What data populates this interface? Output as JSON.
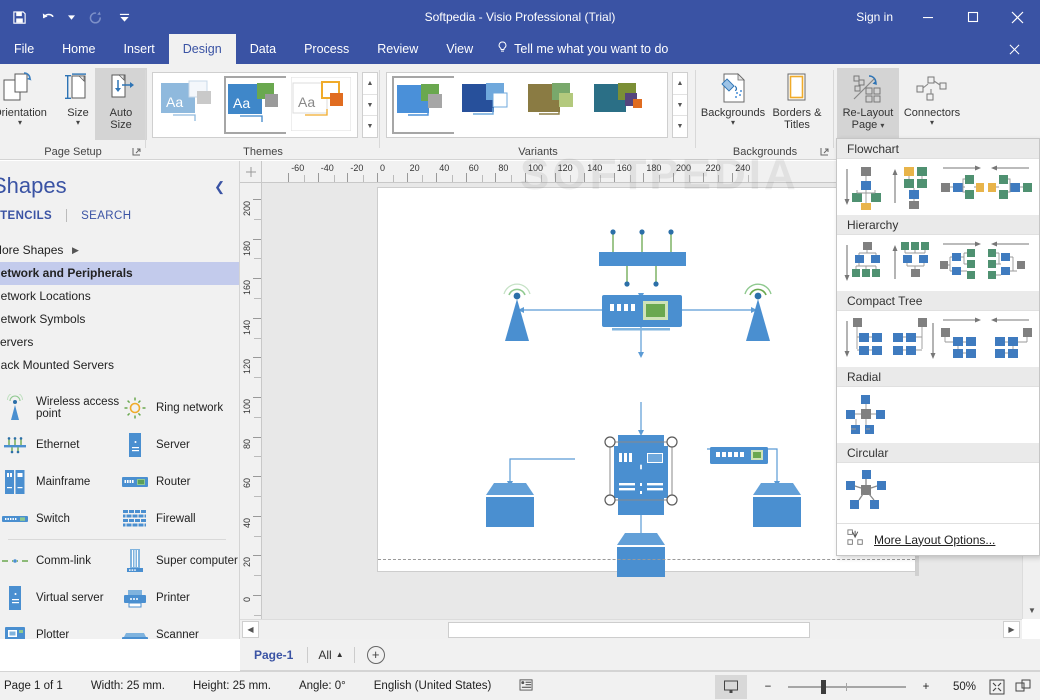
{
  "titlebar": {
    "document_title": "Softpedia - Visio Professional (Trial)",
    "signin": "Sign in",
    "qat": [
      {
        "name": "save-icon",
        "label": "Save"
      },
      {
        "name": "undo-icon",
        "label": "Undo"
      },
      {
        "name": "redo-icon",
        "label": "Redo"
      },
      {
        "name": "customize-qat-icon",
        "label": "Customize Quick Access Toolbar"
      }
    ],
    "window_buttons": [
      {
        "name": "minimize-button",
        "glyph": "minimize"
      },
      {
        "name": "maximize-button",
        "glyph": "maximize"
      },
      {
        "name": "close-button",
        "glyph": "close"
      }
    ],
    "accent_color": "#3a53a4"
  },
  "ribbon_tabs": [
    {
      "label": "File",
      "active": false
    },
    {
      "label": "Home",
      "active": false
    },
    {
      "label": "Insert",
      "active": false
    },
    {
      "label": "Design",
      "active": true
    },
    {
      "label": "Data",
      "active": false
    },
    {
      "label": "Process",
      "active": false
    },
    {
      "label": "Review",
      "active": false
    },
    {
      "label": "View",
      "active": false
    }
  ],
  "tellme": "Tell me what you want to do",
  "ribbon": {
    "groups": [
      {
        "name": "page-setup",
        "label": "Page Setup"
      },
      {
        "name": "themes",
        "label": "Themes"
      },
      {
        "name": "variants",
        "label": "Variants"
      },
      {
        "name": "backgrounds",
        "label": "Backgrounds"
      },
      {
        "name": "layout",
        "label": ""
      }
    ],
    "page_setup": {
      "orientation": "Orientation",
      "size": "Size",
      "autosize_line1": "Auto",
      "autosize_line2": "Size"
    },
    "backgrounds": {
      "backgrounds": "Backgrounds",
      "borders_line1": "Borders &",
      "borders_line2": "Titles"
    },
    "layout": {
      "relayout_line1": "Re-Layout",
      "relayout_line2": "Page",
      "connectors": "Connectors"
    }
  },
  "shapes_panel": {
    "title": "Shapes",
    "tab_stencils": "STENCILS",
    "tab_search": "SEARCH",
    "collapse_icon": "chevron-left-icon",
    "stencils": [
      {
        "label": "More Shapes",
        "has_arrow": true,
        "selected": false
      },
      {
        "label": "Network and Peripherals",
        "has_arrow": false,
        "selected": true
      },
      {
        "label": "Network Locations",
        "has_arrow": false,
        "selected": false
      },
      {
        "label": "Network Symbols",
        "has_arrow": false,
        "selected": false
      },
      {
        "label": "Servers",
        "has_arrow": false,
        "selected": false
      },
      {
        "label": "Rack Mounted Servers",
        "has_arrow": false,
        "selected": false
      }
    ],
    "shapes": [
      {
        "label": "Wireless access point",
        "icon": "wireless-access-point-icon"
      },
      {
        "label": "Ring network",
        "icon": "ring-network-icon"
      },
      {
        "label": "Ethernet",
        "icon": "ethernet-icon"
      },
      {
        "label": "Server",
        "icon": "server-icon"
      },
      {
        "label": "Mainframe",
        "icon": "mainframe-icon"
      },
      {
        "label": "Router",
        "icon": "router-icon"
      },
      {
        "label": "Switch",
        "icon": "switch-icon"
      },
      {
        "label": "Firewall",
        "icon": "firewall-icon"
      },
      {
        "label": "Comm-link",
        "icon": "comm-link-icon"
      },
      {
        "label": "Super computer",
        "icon": "super-computer-icon"
      },
      {
        "label": "Virtual server",
        "icon": "virtual-server-icon"
      },
      {
        "label": "Printer",
        "icon": "printer-icon"
      },
      {
        "label": "Plotter",
        "icon": "plotter-icon"
      },
      {
        "label": "Scanner",
        "icon": "scanner-icon"
      }
    ]
  },
  "rulers": {
    "horizontal_ticks": [
      "-60",
      "-40",
      "-20",
      "0",
      "20",
      "40",
      "60",
      "80",
      "100",
      "120",
      "140",
      "160",
      "180",
      "200",
      "220",
      "240"
    ],
    "vertical_ticks": [
      "200",
      "180",
      "160",
      "140",
      "120",
      "100",
      "80",
      "60",
      "40",
      "20",
      "0"
    ]
  },
  "relayout_dropdown": {
    "sections": [
      {
        "title": "Flowchart",
        "count": 4
      },
      {
        "title": "Hierarchy",
        "count": 4
      },
      {
        "title": "Compact Tree",
        "count": 4
      },
      {
        "title": "Radial",
        "count": 1
      },
      {
        "title": "Circular",
        "count": 1
      }
    ],
    "more_options": "More Layout Options...",
    "more_options_icon": "layout-options-icon"
  },
  "page_tabs": {
    "current_page": "Page-1",
    "all_label": "All",
    "add_page_icon": "add-page-icon"
  },
  "statusbar": {
    "page_of": "Page 1 of 1",
    "width": "Width: 25 mm.",
    "height": "Height: 25 mm.",
    "angle": "Angle: 0°",
    "language": "English (United States)",
    "macro_icon": "macro-record-icon",
    "zoom_percent": "50%",
    "zoom_minus": "−",
    "zoom_plus": "+",
    "fit_page_icon": "fit-page-icon",
    "fit_window_icon": "fit-window-icon",
    "view_icon": "presentation-view-icon"
  },
  "diagram": {
    "watermark": "SOFTPEDIA",
    "shape_fill": "#4a8fd0",
    "connector_color": "#5b9bd5",
    "nodes": [
      {
        "name": "ethernet-backbone",
        "type": "ethernet"
      },
      {
        "name": "router-center",
        "type": "router"
      },
      {
        "name": "wireless-access-point-left",
        "type": "wireless-access-point"
      },
      {
        "name": "wireless-access-point-right",
        "type": "wireless-access-point"
      },
      {
        "name": "server-center",
        "type": "server"
      },
      {
        "name": "switch-standalone",
        "type": "switch"
      },
      {
        "name": "mainframe-selected",
        "type": "mainframe",
        "selected": true
      },
      {
        "name": "building-left",
        "type": "building"
      },
      {
        "name": "building-center",
        "type": "building"
      },
      {
        "name": "building-right",
        "type": "building"
      }
    ]
  }
}
